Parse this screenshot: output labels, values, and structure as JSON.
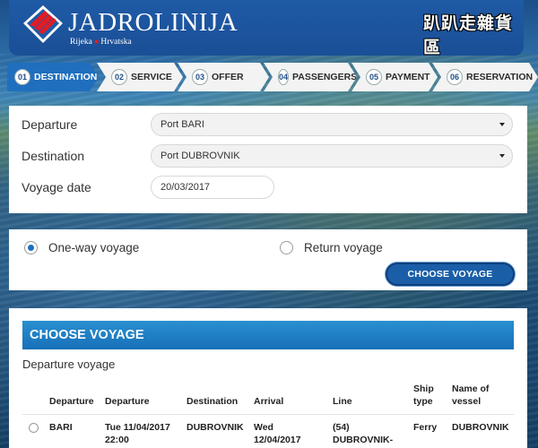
{
  "header": {
    "brand": "JADROLINIJA",
    "sub_left": "Rijeka",
    "sub_sep": "■",
    "sub_right": "Hrvatska",
    "watermark": "趴趴走雜貨區",
    "colors": {
      "header_bg": "#1f5aa6",
      "logo_red": "#e31b23"
    }
  },
  "steps": [
    {
      "num": "01",
      "label": "DESTINATION",
      "active": true
    },
    {
      "num": "02",
      "label": "SERVICE"
    },
    {
      "num": "03",
      "label": "OFFER"
    },
    {
      "num": "04",
      "label": "PASSENGERS"
    },
    {
      "num": "05",
      "label": "PAYMENT"
    },
    {
      "num": "06",
      "label": "RESERVATION"
    }
  ],
  "form": {
    "departure_label": "Departure",
    "departure_value": "Port BARI",
    "destination_label": "Destination",
    "destination_value": "Port DUBROVNIK",
    "date_label": "Voyage date",
    "date_value": "20/03/2017"
  },
  "voyage_type": {
    "one_way": "One-way voyage",
    "return": "Return voyage",
    "selected": "one_way",
    "choose_button": "CHOOSE VOYAGE"
  },
  "results": {
    "title": "CHOOSE VOYAGE",
    "subtitle": "Departure voyage",
    "columns": {
      "departure_port": "Departure",
      "departure_time": "Departure",
      "destination": "Destination",
      "arrival": "Arrival",
      "line": "Line",
      "ship_type_1": "Ship",
      "ship_type_2": "type",
      "vessel_1": "Name of",
      "vessel_2": "vessel"
    },
    "rows": [
      {
        "departure_port": "BARI",
        "departure_time_1": "Tue 11/04/2017",
        "departure_time_2": "22:00",
        "destination": "DUBROVNIK",
        "arrival_1": "Wed",
        "arrival_2": "12/04/2017",
        "line_1": "(54)",
        "line_2": "DUBROVNIK-",
        "ship_type": "Ferry",
        "vessel": "DUBROVNIK"
      }
    ]
  }
}
